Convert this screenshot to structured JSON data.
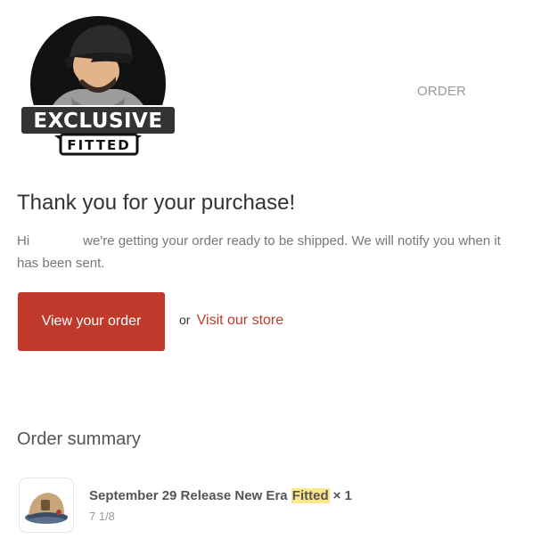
{
  "header": {
    "logo": {
      "text_top": "EXCLUSIVE",
      "text_bottom": "FITTED"
    },
    "order_label": "ORDER"
  },
  "message": {
    "heading": "Thank you for your purchase!",
    "greeting": "Hi",
    "body": "we're getting your order ready to be shipped. We will notify you when it has been sent."
  },
  "actions": {
    "view_order_label": "View your order",
    "or_text": "or",
    "visit_store_label": "Visit our store"
  },
  "summary": {
    "title": "Order summary",
    "items": [
      {
        "name_prefix": "September 29 Release New Era",
        "name_highlight": "Fitted",
        "quantity": "× 1",
        "variant": "7 1/8"
      }
    ]
  },
  "colors": {
    "button": "#c0392b",
    "link": "#c0392b",
    "highlight": "#fde68a"
  }
}
